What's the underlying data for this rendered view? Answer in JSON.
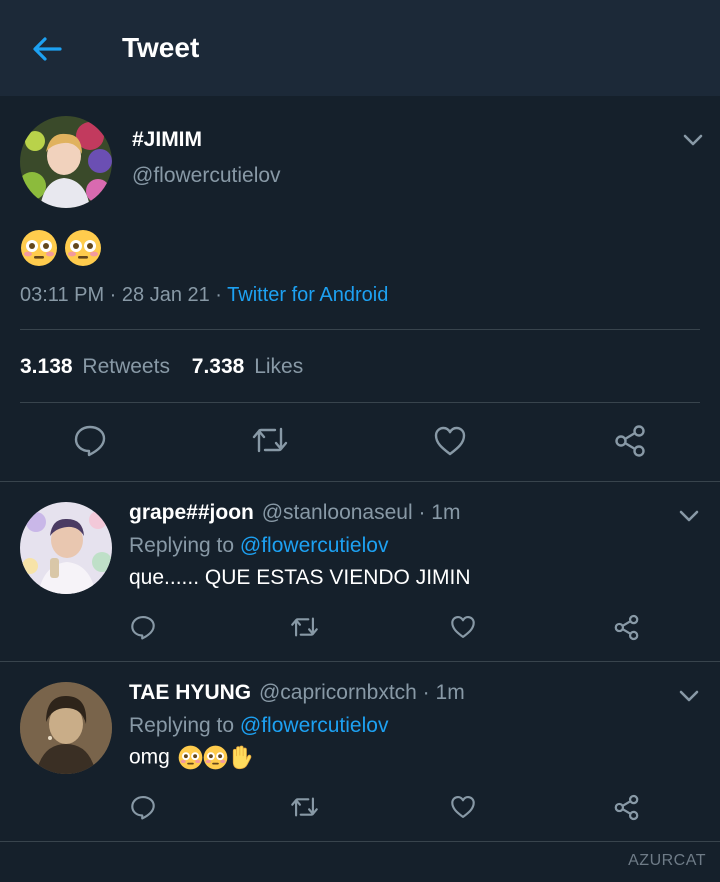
{
  "header": {
    "title": "Tweet"
  },
  "main_tweet": {
    "display_name": "#JIMIM",
    "handle": "@flowercutielov",
    "body_emoji": "flushed-face-emoji x2",
    "time": "03:11 PM · 28 Jan 21 · ",
    "source": "Twitter for Android",
    "retweet_count": "3.138",
    "retweet_label": "Retweets",
    "like_count": "7.338",
    "like_label": "Likes"
  },
  "replies": [
    {
      "display_name": "grape##joon",
      "meta": "@stanloonaseul · 1m",
      "replying_prefix": "Replying to ",
      "replying_to": "@flowercutielov",
      "text": "que...... QUE ESTAS VIENDO JIMIN"
    },
    {
      "display_name": "TAE HYUNG",
      "meta": "@capricornbxtch · 1m",
      "replying_prefix": "Replying to ",
      "replying_to": "@flowercutielov",
      "text": "omg"
    }
  ],
  "watermark": "AZURCAT",
  "colors": {
    "background": "#15202b",
    "header": "#1c2938",
    "accent": "#1da1f2",
    "muted": "#8899a6",
    "separator": "#38444d"
  }
}
